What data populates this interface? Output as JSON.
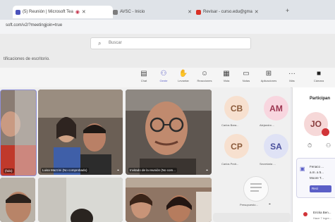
{
  "browser": {
    "tabs": [
      {
        "label": "(5) Reunión | Microsoft Tea",
        "favicon_color": "#4b53bc",
        "active": true
      },
      {
        "label": "AVSC - Inicio",
        "favicon_color": "#7d7d7d",
        "active": false
      },
      {
        "label": "Revisar - curso.edu@gma",
        "favicon_color": "#d93025",
        "active": false
      }
    ],
    "url": "soft.com/v2/?meetingjoin=true"
  },
  "header": {
    "search_placeholder": "Buscar",
    "notification": "tificaciones de escritorio."
  },
  "toolbar": {
    "items": [
      {
        "label": "Chat",
        "icon": "chat-icon",
        "glyph": "▤"
      },
      {
        "label": "Gente",
        "icon": "people-icon",
        "glyph": "⚇",
        "selected": true
      },
      {
        "label": "Levantar",
        "icon": "raise-hand-icon",
        "glyph": "✋"
      },
      {
        "label": "Reacciones",
        "icon": "smile-icon",
        "glyph": "☺"
      },
      {
        "label": "Vista",
        "icon": "grid-icon",
        "glyph": "▦"
      },
      {
        "label": "Notas",
        "icon": "notes-icon",
        "glyph": "▭"
      },
      {
        "label": "Aplicaciones",
        "icon": "apps-icon",
        "glyph": "⊞"
      },
      {
        "label": "Más",
        "icon": "more-icon",
        "glyph": "···"
      },
      {
        "label": "Cámara",
        "icon": "camera-icon",
        "glyph": "■"
      }
    ]
  },
  "tiles": [
    {
      "caption": "(hdo)"
    },
    {
      "caption": "Luisa Mazzini (No comprobado)"
    },
    {
      "caption": "Invitado de la reunión (No com..."
    },
    {
      "caption": ""
    },
    {
      "caption": ""
    },
    {
      "caption": ""
    }
  ],
  "avatars": [
    {
      "initials": "CB",
      "name": "Carlos Bara...",
      "bg": "#f7e0cf",
      "fg": "#8a5a3a"
    },
    {
      "initials": "AM",
      "name": "Alejandra ...",
      "bg": "#f8d6df",
      "fg": "#9c3550"
    },
    {
      "initials": "CP",
      "name": "Carlos Pedr...",
      "bg": "#f7e0cf",
      "fg": "#8a5a3a"
    },
    {
      "initials": "SA",
      "name": "Secretaria ...",
      "bg": "#dfe2f5",
      "fg": "#4a4f9c"
    }
  ],
  "presentation_label": "Presupuesto...",
  "panel": {
    "title": "Participan",
    "me_initials": "JO",
    "card_lines": [
      "Fenaco ...",
      "a.m. a 5...",
      "Moore T..."
    ],
    "card_button": "Reci",
    "footer_name": "Ericka Ben...",
    "footer_sub": "Hace 7 ingre..."
  },
  "colors": {
    "accent": "#5b5fc7",
    "record": "#d13438"
  }
}
